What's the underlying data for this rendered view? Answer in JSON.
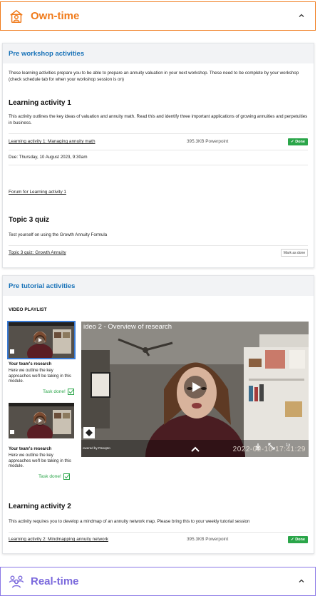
{
  "own_time": {
    "title": "Own-time",
    "icon": "person-clock-icon",
    "accent": "#f07a1a"
  },
  "pre_workshop": {
    "heading": "Pre workshop activities",
    "intro": "These learning activities prepare you to be able to prepare an annuity valuation in your next workshop. These need to be complete by your workshop (check schedule tab for when your workshop session is on)",
    "activity1": {
      "title": "Learning activity 1",
      "description": "This activity outlines the key ideas of valuation and annuity math. Read this and identify three important applications of growing annuities and perpetuities in business.",
      "link": "Learning activity 1: Managing annuity math",
      "size": "395.3KB Powerpoint",
      "status": "Done",
      "due": "Due: Thursday, 10 August 2023, 9:30am",
      "forum": "Forum for Learning activity 1"
    },
    "quiz": {
      "title": "Topic 3 quiz",
      "description": "Test yourself on using the Growth Annuity Formula",
      "link": "Topic 3 quiz: Growth Annuity",
      "button": "Mark as done"
    }
  },
  "pre_tutorial": {
    "heading": "Pre tutorial activities",
    "playlist_label": "VIDEO PLAYLIST",
    "playlist": [
      {
        "title": "Your team's research",
        "description": "Here we outline the key approaches we'll be taking in this module.",
        "status": "Task done!"
      },
      {
        "title": "Your team's research",
        "description": "Here we outline the key approaches we'll be taking in this module.",
        "status": "Task done!"
      }
    ],
    "video": {
      "title": "ideo 2 - Overview of research",
      "timestamp": "2022-02-10  17:41:29",
      "powered": "owered by Panopto",
      "speed": "1x"
    },
    "activity2": {
      "title": "Learning activity 2",
      "description": "This activity requires you to develop a mindmap of an annuity network map. Please bring this to your weekly tutorial session",
      "link": "Learning activity 2: Mindmapping annuity network",
      "size": "395.3KB Powerpoint",
      "status": "Done"
    }
  },
  "real_time": {
    "title": "Real-time",
    "icon": "group-icon",
    "accent": "#7a68dc"
  }
}
